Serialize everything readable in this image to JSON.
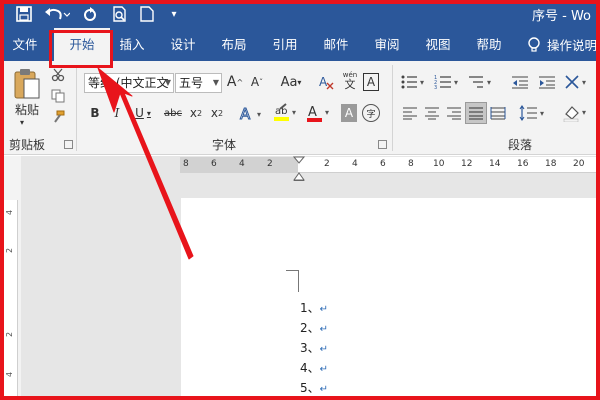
{
  "title_bar": {
    "document_title": "序号 - Wo"
  },
  "tabs": [
    {
      "label": "文件",
      "active": false
    },
    {
      "label": "开始",
      "active": true
    },
    {
      "label": "插入",
      "active": false
    },
    {
      "label": "设计",
      "active": false
    },
    {
      "label": "布局",
      "active": false
    },
    {
      "label": "引用",
      "active": false
    },
    {
      "label": "邮件",
      "active": false
    },
    {
      "label": "审阅",
      "active": false
    },
    {
      "label": "视图",
      "active": false
    },
    {
      "label": "帮助",
      "active": false
    }
  ],
  "tell_me": {
    "label": "操作说明"
  },
  "clipboard": {
    "paste_label": "粘贴",
    "group_label": "剪贴板"
  },
  "font": {
    "font_name": "等线 (中文正文",
    "font_size": "五号",
    "group_label": "字体",
    "wen_pinyin": "wén",
    "wen_char": "文"
  },
  "paragraph": {
    "group_label": "段落"
  },
  "ruler": {
    "numbers": [
      "8",
      "6",
      "4",
      "2",
      "2",
      "4",
      "6",
      "8",
      "10",
      "12",
      "14",
      "16",
      "18",
      "20"
    ]
  },
  "vertical_ruler": {
    "numbers": [
      "4",
      "2",
      "2",
      "4"
    ]
  },
  "document": {
    "lines": [
      "1、",
      "2、",
      "3、",
      "4、",
      "5、"
    ],
    "para_mark": "↵"
  },
  "colors": {
    "accent": "#2b579a",
    "highlight": "#e8141b",
    "font_color": "#e8141b",
    "highlight_color": "#ffff00"
  }
}
